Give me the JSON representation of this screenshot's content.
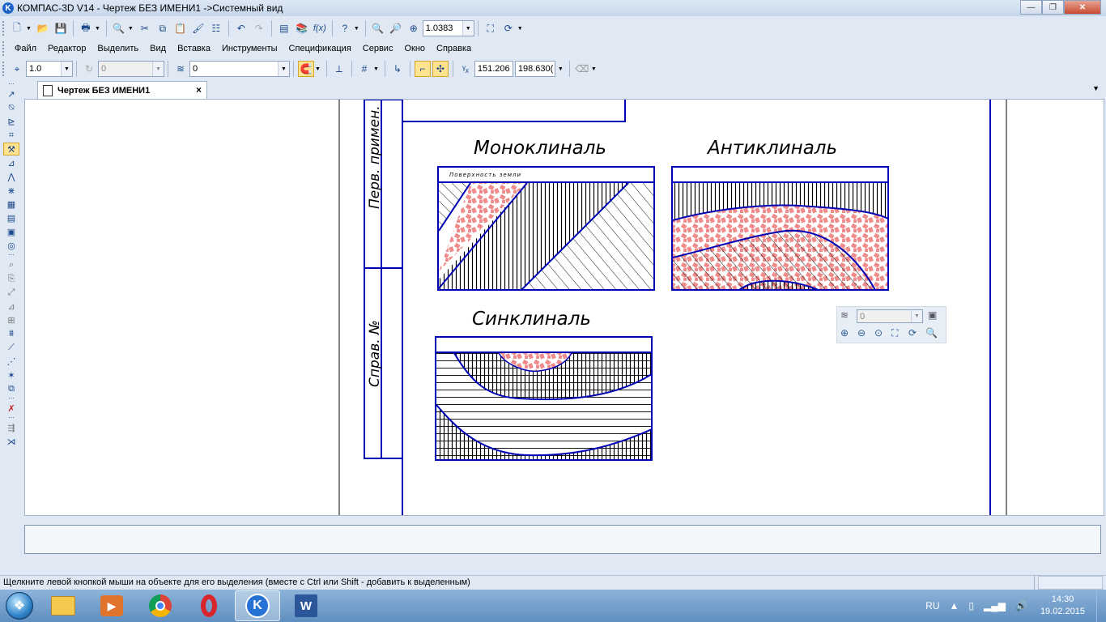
{
  "window": {
    "title": "КОМПАС-3D V14 - Чертеж БЕЗ ИМЕНИ1 ->Системный вид",
    "app_icon_letter": "K",
    "minimize": "—",
    "maximize": "❐",
    "close": "✕"
  },
  "toolbar_top": {
    "zoom_value": "1.0383"
  },
  "menu": {
    "items": [
      "Файл",
      "Редактор",
      "Выделить",
      "Вид",
      "Вставка",
      "Инструменты",
      "Спецификация",
      "Сервис",
      "Окно",
      "Справка"
    ]
  },
  "toolbar_current": {
    "step_value": "1.0",
    "angle_value": "0",
    "layer_value": "0",
    "coord_x": "151.206",
    "coord_y": "198.630("
  },
  "doc_tab": {
    "label": "Чертеж БЕЗ ИМЕНИ1",
    "close": "×"
  },
  "drawing": {
    "stamp_label_top": "Перв. примен.",
    "stamp_label_bottom": "Справ. №",
    "titles": {
      "monocline": "Моноклиналь",
      "anticline": "Антиклиналь",
      "syncline": "Синклиналь"
    },
    "ground_surface": "Поверхность земли"
  },
  "mini_toolbar": {
    "layer_value": "0"
  },
  "statusbar": {
    "text": "Щелкните левой кнопкой мыши на объекте для его выделения (вместе с Ctrl или Shift - добавить к выделенным)"
  },
  "taskbar": {
    "language": "RU",
    "time": "14:30",
    "date": "19.02.2015"
  },
  "colors": {
    "drawing_line": "#0000b4",
    "sand_fill": "#f08c8c",
    "ui_bg": "#dfe8f3"
  }
}
